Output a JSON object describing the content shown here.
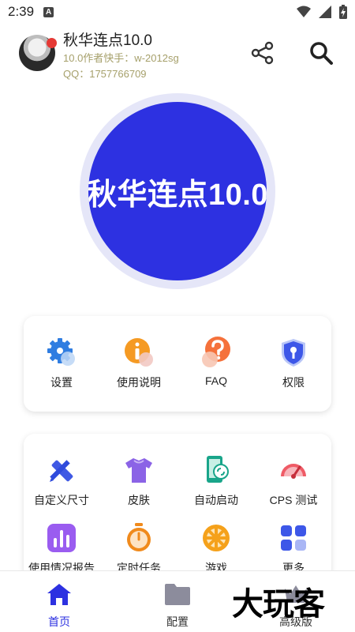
{
  "status_bar": {
    "time": "2:39",
    "notification_icon": "A"
  },
  "header": {
    "title": "秋华连点10.0",
    "author_line": "10.0作者快手：w-2012sg",
    "qq_line": "QQ：1757766709"
  },
  "hero": {
    "text": "秋华连点10.0",
    "color": "#2d31e1",
    "ring_color": "#e5e6f8"
  },
  "quick_menu": [
    {
      "label": "设置",
      "icon": "gear-icon"
    },
    {
      "label": "使用说明",
      "icon": "info-icon"
    },
    {
      "label": "FAQ",
      "icon": "question-icon"
    },
    {
      "label": "权限",
      "icon": "shield-icon"
    }
  ],
  "tools_menu": [
    {
      "label": "自定义尺寸",
      "icon": "ruler-pencil-icon"
    },
    {
      "label": "皮肤",
      "icon": "tshirt-icon"
    },
    {
      "label": "自动启动",
      "icon": "phone-link-icon"
    },
    {
      "label": "CPS 测试",
      "icon": "speedometer-icon"
    },
    {
      "label": "使用情况报告",
      "icon": "bar-chart-icon"
    },
    {
      "label": "定时任务",
      "icon": "timer-icon"
    },
    {
      "label": "游戏",
      "icon": "wheel-icon"
    },
    {
      "label": "更多",
      "icon": "grid-icon"
    }
  ],
  "bottom_nav": [
    {
      "label": "首页",
      "icon": "home-icon",
      "active": true
    },
    {
      "label": "配置",
      "icon": "folder-icon",
      "active": false
    },
    {
      "label": "高级版",
      "icon": "crown-icon",
      "active": false
    }
  ],
  "watermark": "大玩客"
}
